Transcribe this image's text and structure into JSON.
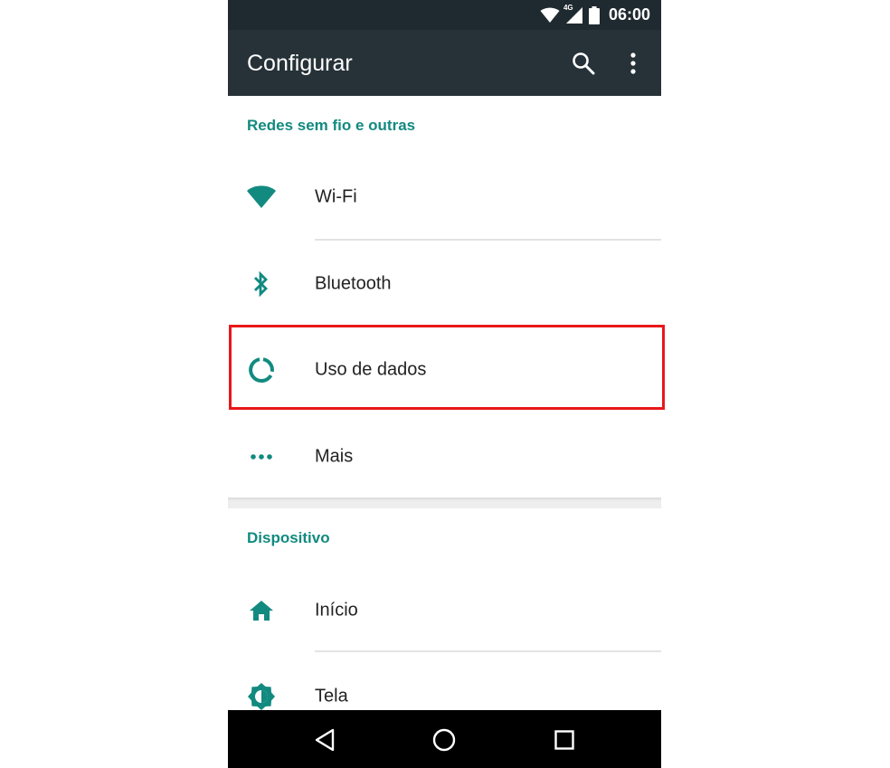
{
  "status_bar": {
    "time": "06:00",
    "network_label": "4G",
    "icons": [
      "wifi-icon",
      "cell-signal-icon",
      "battery-icon"
    ]
  },
  "app_bar": {
    "title": "Configurar",
    "actions": [
      "search-icon",
      "more-vert-icon"
    ]
  },
  "sections": [
    {
      "header": "Redes sem fio e outras",
      "items": [
        {
          "label": "Wi-Fi",
          "icon": "wifi-icon"
        },
        {
          "label": "Bluetooth",
          "icon": "bluetooth-icon"
        },
        {
          "label": "Uso de dados",
          "icon": "data-usage-icon",
          "highlighted": true
        },
        {
          "label": "Mais",
          "icon": "more-horiz-icon"
        }
      ]
    },
    {
      "header": "Dispositivo",
      "items": [
        {
          "label": "Início",
          "icon": "home-icon"
        },
        {
          "label": "Tela",
          "icon": "brightness-icon"
        }
      ]
    }
  ],
  "nav_bar": {
    "buttons": [
      "back-icon",
      "home-circle-icon",
      "recents-icon"
    ]
  },
  "colors": {
    "accent": "#128a80",
    "app_bar": "#263238",
    "status_bar": "#1f2a30",
    "highlight_border": "#e8181b",
    "nav_bar": "#000000"
  }
}
